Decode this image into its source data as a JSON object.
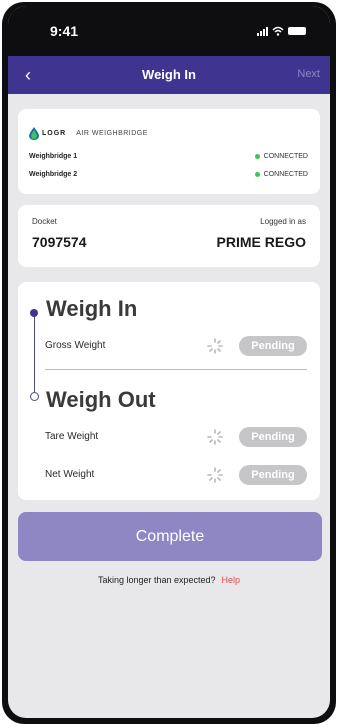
{
  "status_bar": {
    "time": "9:41"
  },
  "nav": {
    "title": "Weigh In",
    "next_label": "Next"
  },
  "brand": {
    "logo_text": "LOGR",
    "subtitle": "AIR WEIGHBRIDGE"
  },
  "weighbridges": [
    {
      "name": "Weighbridge 1",
      "status": "CONNECTED"
    },
    {
      "name": "Weighbridge 2",
      "status": "CONNECTED"
    }
  ],
  "docket": {
    "label": "Docket",
    "value": "7097574"
  },
  "logged_in": {
    "label": "Logged in as",
    "value": "PRIME REGO"
  },
  "weigh_in": {
    "title": "Weigh In",
    "rows": [
      {
        "label": "Gross Weight",
        "status": "Pending"
      }
    ]
  },
  "weigh_out": {
    "title": "Weigh Out",
    "rows": [
      {
        "label": "Tare Weight",
        "status": "Pending"
      },
      {
        "label": "Net Weight",
        "status": "Pending"
      }
    ]
  },
  "actions": {
    "complete_label": "Complete"
  },
  "help": {
    "text": "Taking longer than expected?",
    "link": "Help"
  },
  "colors": {
    "header_bg": "#3f3590",
    "button_bg": "#8f87c4",
    "connected_dot": "#3dc45a",
    "pending_pill": "#c6c6c8",
    "help_link": "#e34b4b"
  }
}
